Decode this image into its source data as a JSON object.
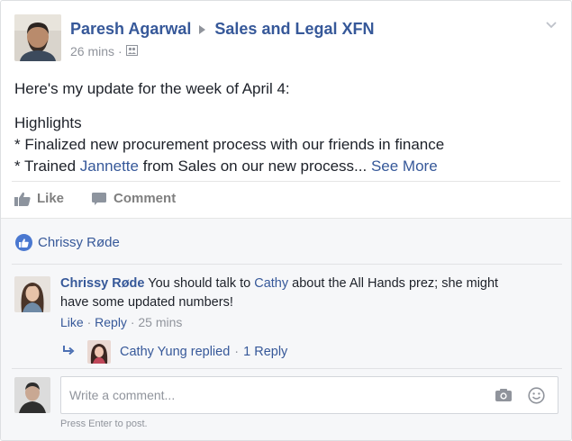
{
  "post": {
    "author": "Paresh Agarwal",
    "group": "Sales and Legal XFN",
    "time": "26 mins",
    "meta_separator": "·",
    "audience_icon": "group-audience-icon",
    "options_icon": "chevron-down-icon",
    "lines": {
      "intro": "Here's my update for the week of April 4:",
      "highlights": "Highlights",
      "bullet1": "* Finalized new procurement process with our friends in finance",
      "bullet2_prefix": "* Trained ",
      "bullet2_mention": "Jannette",
      "bullet2_suffix": " from Sales on our new process... ",
      "see_more": "See More"
    }
  },
  "actions": {
    "like": "Like",
    "comment": "Comment",
    "like_icon": "thumbs-up-icon",
    "comment_icon": "comment-bubble-icon"
  },
  "likers": {
    "text": "Chrissy Røde",
    "icon": "like-badge-icon"
  },
  "comment": {
    "author": "Chrissy Røde",
    "text_before": " You should talk to ",
    "mention": "Cathy",
    "text_after": " about the All Hands prez; she might have some updated numbers!",
    "like": "Like",
    "reply": "Reply",
    "time": "25 mins",
    "separator": "·"
  },
  "reply": {
    "text": "Cathy Yung replied",
    "separator": "·",
    "count": "1 Reply",
    "icon": "reply-arrow-icon"
  },
  "composer": {
    "placeholder": "Write a comment...",
    "hint": "Press Enter to post.",
    "camera_icon": "camera-icon",
    "emoji_icon": "smiley-icon"
  },
  "colors": {
    "link": "#365899",
    "muted": "#90949c",
    "text": "#1d2129",
    "comments_bg": "#f6f7f9",
    "like_badge": "#4a78d0"
  }
}
